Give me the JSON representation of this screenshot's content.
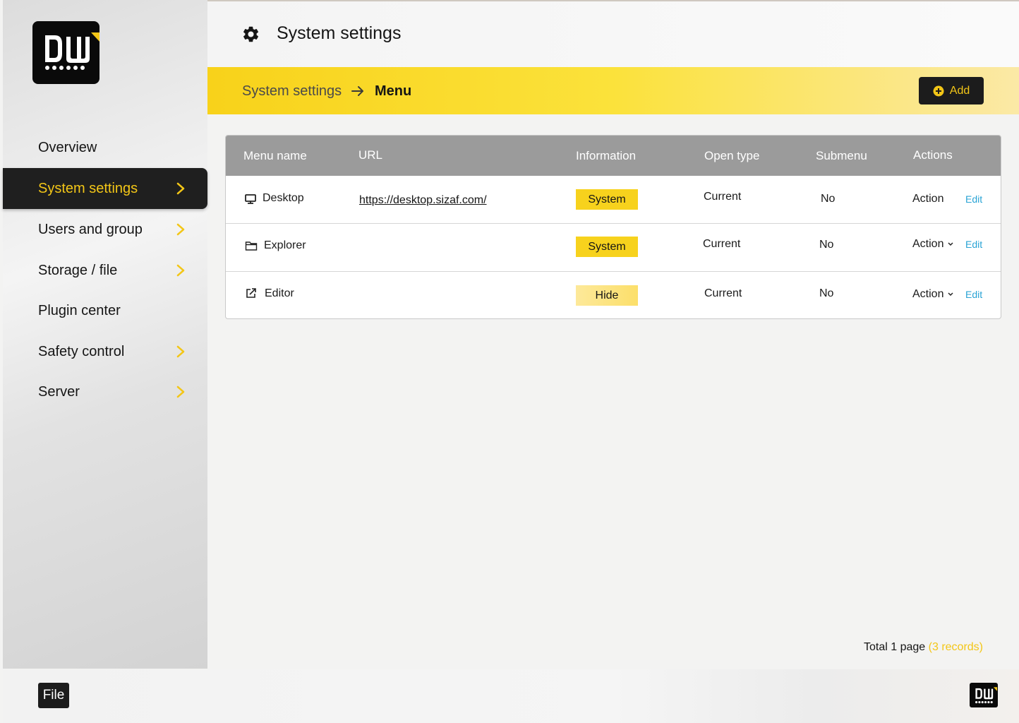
{
  "sidebar": {
    "items": [
      {
        "label": "Overview",
        "has_arrow": false
      },
      {
        "label": "System settings",
        "has_arrow": true,
        "active": true
      },
      {
        "label": "Users and group",
        "has_arrow": true
      },
      {
        "label": "Storage / file",
        "has_arrow": true
      },
      {
        "label": "Plugin center",
        "has_arrow": false
      },
      {
        "label": "Safety control",
        "has_arrow": true
      },
      {
        "label": "Server",
        "has_arrow": true
      }
    ]
  },
  "header": {
    "icon": "gear-icon",
    "title": "System settings"
  },
  "breadcrumb": {
    "parent": "System settings",
    "current": "Menu",
    "add_label": "Add"
  },
  "table": {
    "columns": [
      "Menu name",
      "URL",
      "Information",
      "Open type",
      "Submenu",
      "Actions"
    ],
    "rows": [
      {
        "icon": "monitor-icon",
        "name": "Desktop",
        "url": "https://desktop.sizaf.com/",
        "info": "System",
        "open_type": "Current",
        "submenu": "No",
        "action": "Action",
        "edit": "Edit"
      },
      {
        "icon": "folder-icon",
        "name": "Explorer",
        "url": "",
        "info": "System",
        "open_type": "Current",
        "submenu": "No",
        "action": "Action",
        "edit": "Edit"
      },
      {
        "icon": "external-edit-icon",
        "name": "Editor",
        "url": "",
        "info": "Hide",
        "open_type": "Current",
        "submenu": "No",
        "action": "Action",
        "edit": "Edit"
      }
    ]
  },
  "footer": {
    "total_text": "Total 1 page",
    "records_text": "(3 records)"
  },
  "bottombar": {
    "file_label": "File"
  },
  "colors": {
    "accent": "#f3c617",
    "dark": "#1c1c1c",
    "header_row": "#9b9b9b",
    "edit_link": "#2aa4d5"
  }
}
